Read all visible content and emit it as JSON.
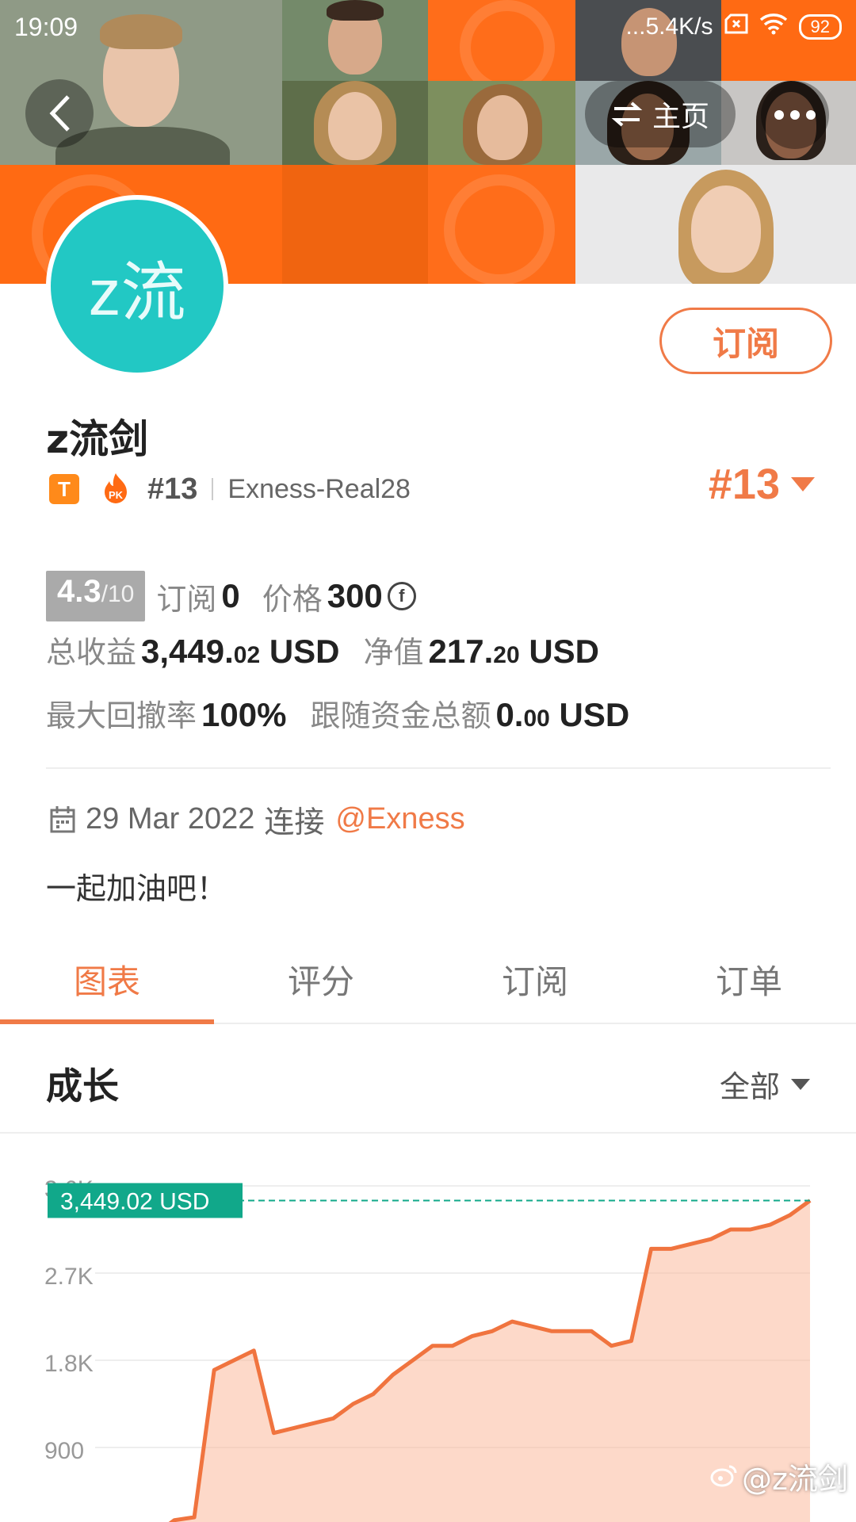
{
  "status_bar": {
    "time": "19:09",
    "network_speed": "...5.4K/s",
    "battery": "92"
  },
  "header": {
    "home_label": "主页"
  },
  "profile": {
    "avatar_text": "z流",
    "subscribe_label": "订阅",
    "username": "z流剑",
    "badge_t": "T",
    "badge_pk": "PK",
    "rank": "#13",
    "account": "Exness-Real28",
    "rank_big": "#13"
  },
  "stats": {
    "score": "4.3",
    "score_max": "/10",
    "subscribers_label": "订阅",
    "subscribers_value": "0",
    "price_label": "价格",
    "price_value": "300",
    "total_profit_label": "总收益",
    "total_profit_main": "3,449.",
    "total_profit_cents": "02",
    "total_profit_unit": " USD",
    "equity_label": "净值",
    "equity_main": "217.",
    "equity_cents": "20",
    "equity_unit": " USD",
    "max_drawdown_label": "最大回撤率",
    "max_drawdown_value": "100%",
    "follow_funds_label": "跟随资金总额",
    "follow_funds_main": "0.",
    "follow_funds_cents": "00",
    "follow_funds_unit": " USD"
  },
  "connection": {
    "date": "29 Mar 2022",
    "connect_label": "连接",
    "broker": "@Exness"
  },
  "motto": "一起加油吧！",
  "tabs": [
    {
      "label": "图表",
      "active": true
    },
    {
      "label": "评分",
      "active": false
    },
    {
      "label": "订阅",
      "active": false
    },
    {
      "label": "订单",
      "active": false
    }
  ],
  "growth": {
    "title": "成长",
    "range_label": "全部"
  },
  "chart_data": {
    "type": "area",
    "y_ticks": [
      "3.6K",
      "2.7K",
      "1.8K",
      "900"
    ],
    "ylim": [
      0,
      3600
    ],
    "current_value_label": "3,449.02 USD",
    "current_value": 3449.02,
    "colors": {
      "line": "#f0743f",
      "fill": "#fbb99c",
      "marker": "#11a88a"
    },
    "values": [
      0,
      150,
      180,
      1700,
      1800,
      1900,
      1050,
      1100,
      1150,
      1200,
      1350,
      1450,
      1650,
      1800,
      1950,
      1950,
      2050,
      2100,
      2200,
      2150,
      2100,
      2100,
      2100,
      1950,
      2000,
      2950,
      2950,
      3000,
      3050,
      3150,
      3150,
      3200,
      3300,
      3449.02
    ]
  },
  "watermark": "@z流剑"
}
